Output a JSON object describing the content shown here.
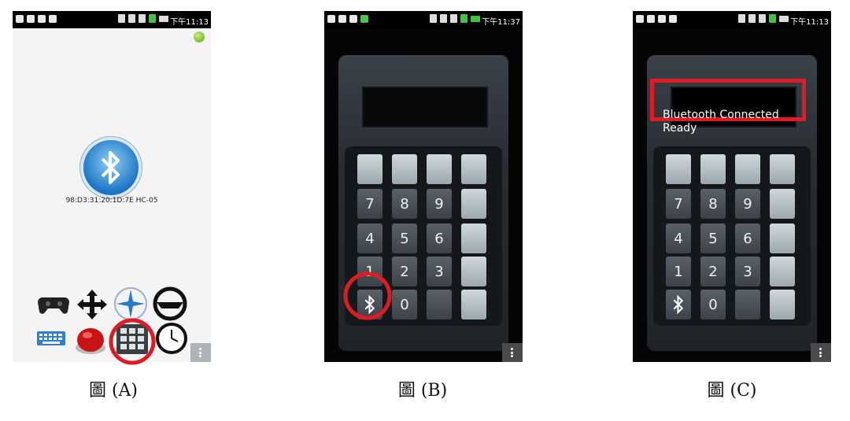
{
  "panel_a": {
    "status_time": "下午11:13",
    "device_address": "98:D3:31:20:1D:7E HC-05",
    "apps": [
      "gamepad-icon",
      "arrows-icon",
      "compass-icon",
      "steering-wheel-icon",
      "keyboard-icon",
      "red-button-icon",
      "keypad-icon",
      "clock-icon"
    ],
    "caption": "圖 (A)"
  },
  "panel_b": {
    "status_time": "下午11:37",
    "keys": [
      [
        "",
        "",
        "",
        ""
      ],
      [
        "7",
        "8",
        "9",
        ""
      ],
      [
        "4",
        "5",
        "6",
        ""
      ],
      [
        "1",
        "2",
        "3",
        ""
      ],
      [
        "bt",
        "0",
        "",
        ""
      ]
    ],
    "caption": "圖 (B)"
  },
  "panel_c": {
    "status_time": "下午11:13",
    "message_line1": "Bluetooth Connected",
    "message_line2": "Ready",
    "keys": [
      [
        "",
        "",
        "",
        ""
      ],
      [
        "7",
        "8",
        "9",
        ""
      ],
      [
        "4",
        "5",
        "6",
        ""
      ],
      [
        "1",
        "2",
        "3",
        ""
      ],
      [
        "bt",
        "0",
        "",
        ""
      ]
    ],
    "caption": "圖 (C)"
  },
  "colors": {
    "highlight": "#e01b24",
    "bt_blue": "#1b74c4"
  }
}
